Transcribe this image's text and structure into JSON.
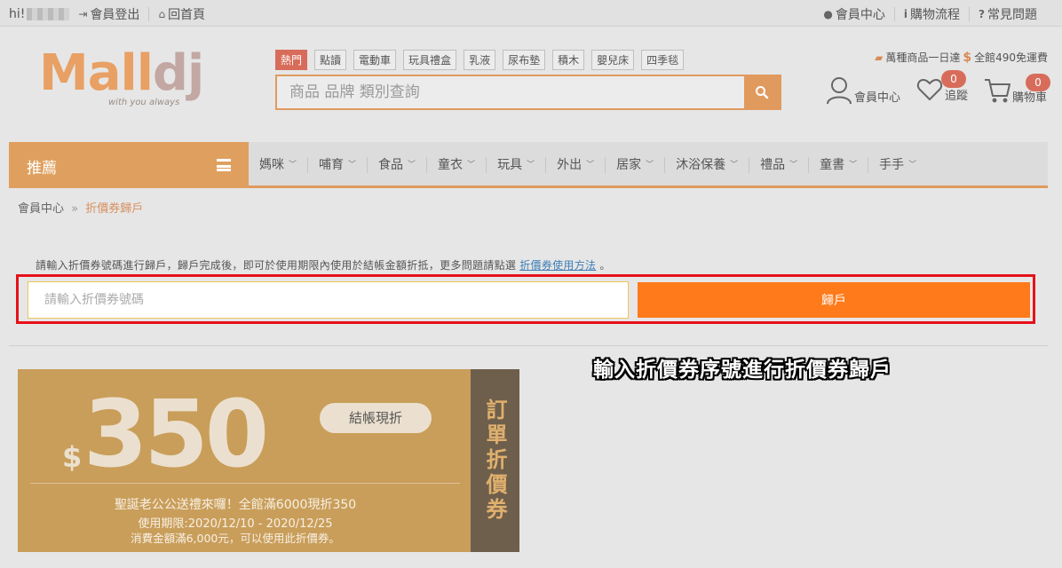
{
  "topbar": {
    "greeting": "hi!",
    "logout": "會員登出",
    "home": "回首頁",
    "member_center": "會員中心",
    "shopping_flow": "購物流程",
    "faq": "常見問題"
  },
  "logo": {
    "text_main": "Mall",
    "text_end": "dj",
    "tagline": "with you always"
  },
  "hot_tags": [
    "熱門",
    "點讀",
    "電動車",
    "玩具禮盒",
    "乳液",
    "尿布墊",
    "積木",
    "嬰兒床",
    "四季毯"
  ],
  "search": {
    "placeholder": "商品 品牌 類別查詢"
  },
  "promo": {
    "text1": "萬種商品一日達",
    "dollar": "$",
    "text2": "全館490免運費"
  },
  "header_icons": {
    "member": "會員中心",
    "track": "追蹤",
    "track_count": "0",
    "cart": "購物車",
    "cart_count": "0"
  },
  "nav": {
    "recommend": "推薦",
    "categories": [
      "媽咪",
      "哺育",
      "食品",
      "童衣",
      "玩具",
      "外出",
      "居家",
      "沐浴保養",
      "禮品",
      "童書",
      "手手"
    ]
  },
  "breadcrumb": {
    "parent": "會員中心",
    "arrow": "»",
    "current": "折價券歸戶"
  },
  "coupon": {
    "info_text": "請輸入折價券號碼進行歸戶，歸戶完成後，即可於使用期限內使用於結帳金額折抵，更多問題請點選",
    "info_link": "折價券使用方法",
    "info_end": "。",
    "input_placeholder": "請輸入折價券號碼",
    "redeem_button": "歸戶",
    "callout": "輸入折價券序號進行折價券歸戶"
  },
  "card": {
    "dollar": "$",
    "amount": "350",
    "pill": "結帳現折",
    "title": "聖誕老公公送禮來囉！全館滿6000現折350",
    "period": "使用期限:2020/12/10 - 2020/12/25",
    "condition": "消費金額滿6,000元，可以使用此折價券。",
    "stub": "訂單折價券"
  },
  "colors": {
    "accent": "#e09a5e",
    "orange_button": "#ff7a1a",
    "highlight_box": "#e6111a",
    "coupon_bg": "#c99e5a",
    "stub_bg": "#6e5f4c"
  }
}
